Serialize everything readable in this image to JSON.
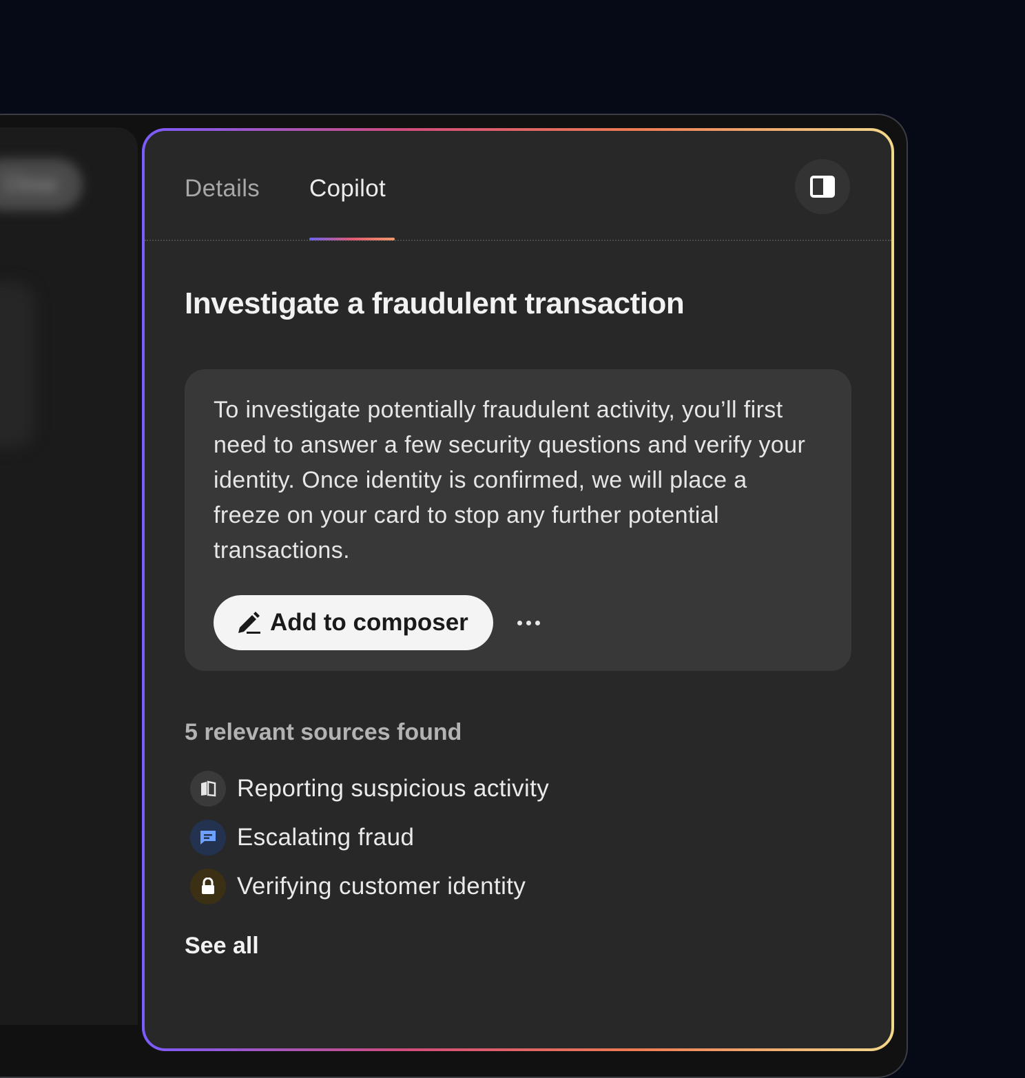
{
  "background_window": {
    "close_label": "Close"
  },
  "tabs": [
    {
      "label": "Details",
      "active": false
    },
    {
      "label": "Copilot",
      "active": true
    }
  ],
  "panel": {
    "title": "Investigate a fraudulent transaction",
    "toggle_icon": "sidebar-toggle-icon"
  },
  "answer": {
    "text": "To investigate potentially fraudulent activity, you’ll first need to answer a few security questions and verify your identity. Once identity is confirmed, we will place a freeze on your card to stop any further potential transactions.",
    "add_button_label": "Add to composer",
    "add_button_icon": "pen-icon",
    "more_icon": "more-icon"
  },
  "sources": {
    "heading": "5 relevant sources found",
    "items": [
      {
        "label": "Reporting suspicious activity",
        "icon": "book-icon",
        "icon_color": "#e6e6e6",
        "icon_bg": "#3a3a3a"
      },
      {
        "label": "Escalating fraud",
        "icon": "chat-icon",
        "icon_color": "#6ea0ff",
        "icon_bg": "#22324f"
      },
      {
        "label": "Verifying customer identity",
        "icon": "lock-icon",
        "icon_color": "#ffffff",
        "icon_bg": "#3b3014"
      }
    ],
    "see_all_label": "See all"
  },
  "colors": {
    "page_bg": "#050a16",
    "panel_bg": "#282828",
    "card_bg": "#383838",
    "gradient_border": [
      "#7b5cff",
      "#d14d7c",
      "#ef7b52",
      "#f3d98a"
    ]
  }
}
